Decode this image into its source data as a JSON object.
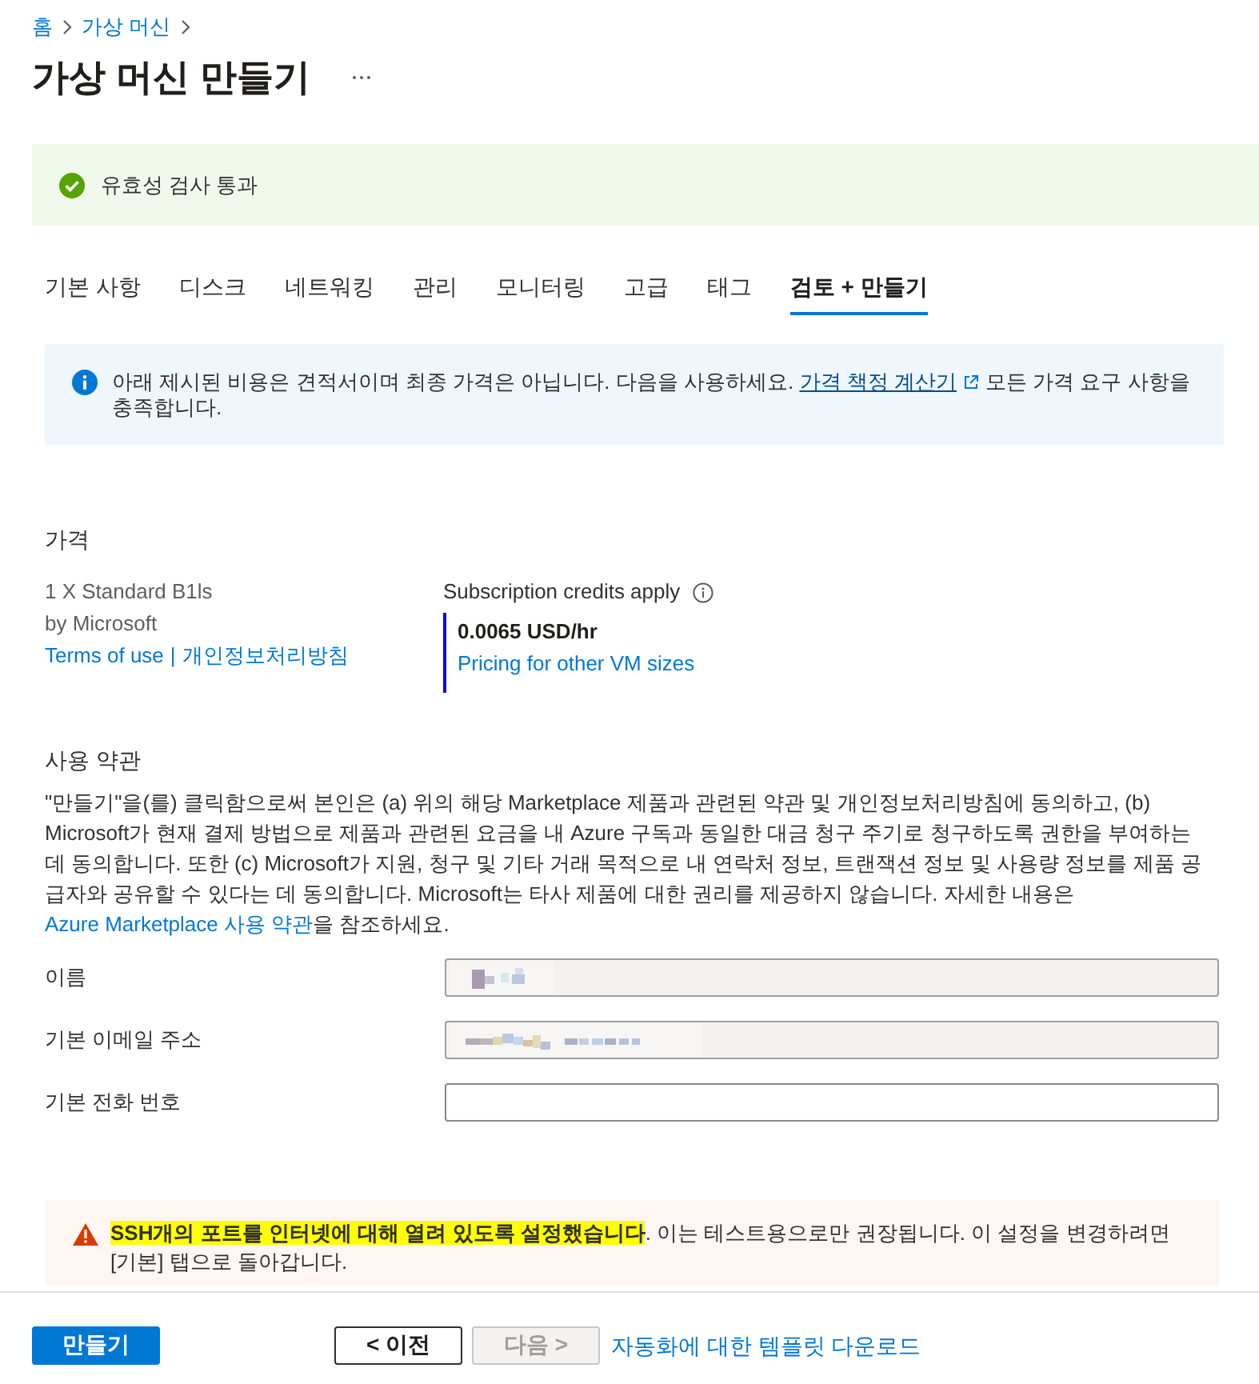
{
  "breadcrumb": [
    {
      "label": "홈"
    },
    {
      "label": "가상 머신"
    }
  ],
  "page": {
    "title": "가상 머신 만들기"
  },
  "validation": {
    "message": "유효성 검사 통과"
  },
  "tabs": [
    {
      "label": "기본 사항",
      "selected": false
    },
    {
      "label": "디스크",
      "selected": false
    },
    {
      "label": "네트워킹",
      "selected": false
    },
    {
      "label": "관리",
      "selected": false
    },
    {
      "label": "모니터링",
      "selected": false
    },
    {
      "label": "고급",
      "selected": false
    },
    {
      "label": "태그",
      "selected": false
    },
    {
      "label": "검토 + 만들기",
      "selected": true
    }
  ],
  "info_banner": {
    "text": "아래 제시된 비용은 견적서이며 최종 가격은 아닙니다. 다음을 사용하세요.",
    "link": "가격 책정 계산기",
    "text_after": "모든 가격 요구 사항을 충족합니다."
  },
  "pricing": {
    "heading": "가격",
    "product": "1 X Standard B1ls",
    "publisher": "by Microsoft",
    "links": [
      "Terms of use",
      "개인정보처리방침"
    ],
    "separator": "|",
    "credits_label": "Subscription credits apply",
    "price": "0.0065 USD/hr",
    "other_sizes_link": "Pricing for other VM sizes"
  },
  "terms": {
    "heading": "사용 약관",
    "text": "\"만들기\"을(를) 클릭함으로써 본인은 (a) 위의 해당 Marketplace 제품과 관련된 약관 및 개인정보처리방침에 동의하고, (b) Microsoft가 현재 결제 방법으로 제품과 관련된 요금을 내 Azure 구독과 동일한 대금 청구 주기로 청구하도록 권한을 부여하는 데 동의합니다. 또한 (c) Microsoft가 지원, 청구 및 기타 거래 목적으로 내 연락처 정보, 트랜잭션 정보 및 사용량 정보를 제품 공급자와 공유할 수 있다는 데 동의합니다. Microsoft는 타사 제품에 대한 권리를 제공하지 않습니다. 자세한 내용은",
    "link": "Azure Marketplace 사용 약관",
    "text_after": "을 참조하세요."
  },
  "contact_fields": [
    {
      "label": "이름",
      "readonly": true,
      "redacted": true
    },
    {
      "label": "기본 이메일 주소",
      "readonly": true,
      "redacted": true
    },
    {
      "label": "기본 전화 번호",
      "readonly": false,
      "redacted": false
    }
  ],
  "warning": {
    "text": "**SSH개의 포트를 인터넷에 대해 열려 있도록 설정했습니다**. 이는 테스트용으로만 권장됩니다. 이 설정을 변경하려면 [기본] 탭으로 돌아갑니다."
  },
  "footer": {
    "buttons": [
      {
        "label": "만들기",
        "kind": "primary",
        "disabled": false
      },
      {
        "label": "< 이전",
        "kind": "secondary",
        "disabled": false
      },
      {
        "label": "다음 >",
        "kind": "secondary",
        "disabled": true
      }
    ],
    "link": "자동화에 대한 템플릿 다운로드"
  }
}
